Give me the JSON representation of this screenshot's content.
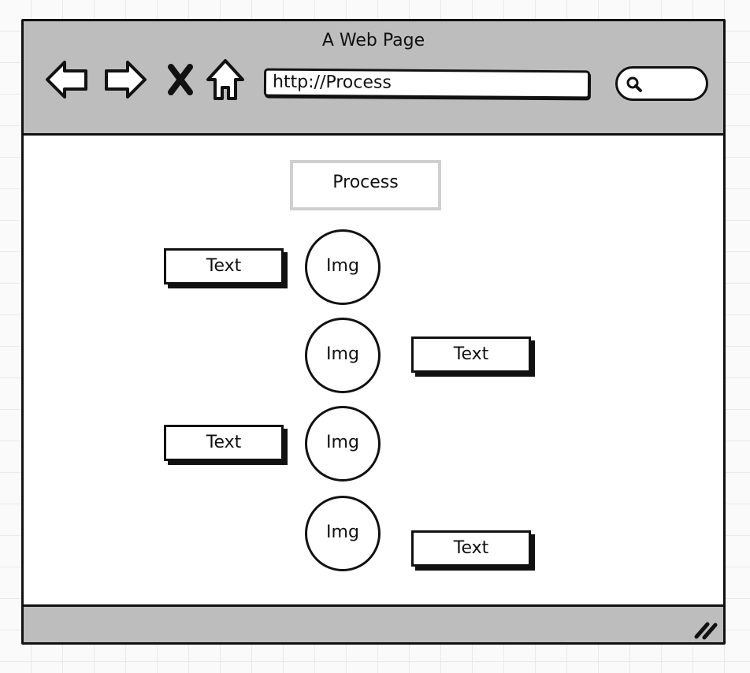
{
  "window": {
    "title": "A Web Page"
  },
  "toolbar": {
    "icons": [
      "back-arrow-icon",
      "forward-arrow-icon",
      "close-x-icon",
      "home-icon"
    ],
    "url": "http://Process",
    "search_icon": "search-icon"
  },
  "main": {
    "process_label": "Process",
    "steps": [
      {
        "img_label": "Img",
        "text_label": "Text",
        "text_side": "left"
      },
      {
        "img_label": "Img",
        "text_label": "Text",
        "text_side": "right"
      },
      {
        "img_label": "Img",
        "text_label": "Text",
        "text_side": "left"
      },
      {
        "img_label": "Img",
        "text_label": "Text",
        "text_side": "right"
      }
    ]
  },
  "footer": {
    "resize_icon": "resize-grip-icon"
  },
  "colors": {
    "chrome": "#bdbdbd",
    "ink": "#111111",
    "process_border": "#cfcfcf"
  }
}
